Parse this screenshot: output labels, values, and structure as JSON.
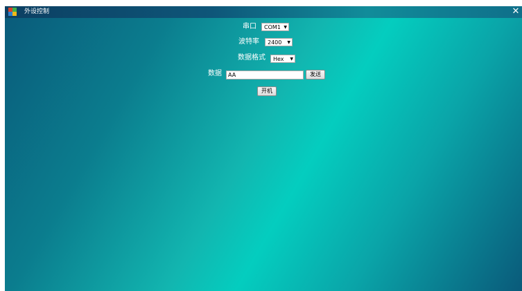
{
  "window": {
    "title": "外设控制",
    "close_glyph": "✕"
  },
  "form": {
    "serial_port": {
      "label": "串口",
      "selected": "COM1"
    },
    "baud_rate": {
      "label": "波特率",
      "selected": "2400"
    },
    "data_format": {
      "label": "数据格式",
      "selected": "Hex"
    },
    "data": {
      "label": "数据",
      "value": "AA",
      "send_label": "发送"
    },
    "power_on_label": "开机"
  },
  "icons": {
    "app": "app-icon",
    "close": "close-icon",
    "dropdown": "chevron-down-icon"
  },
  "colors": {
    "titlebar": "#0e5679",
    "background_teal": "#04cdbf",
    "background_dark": "#0a5a7a",
    "text": "#ffffff"
  }
}
